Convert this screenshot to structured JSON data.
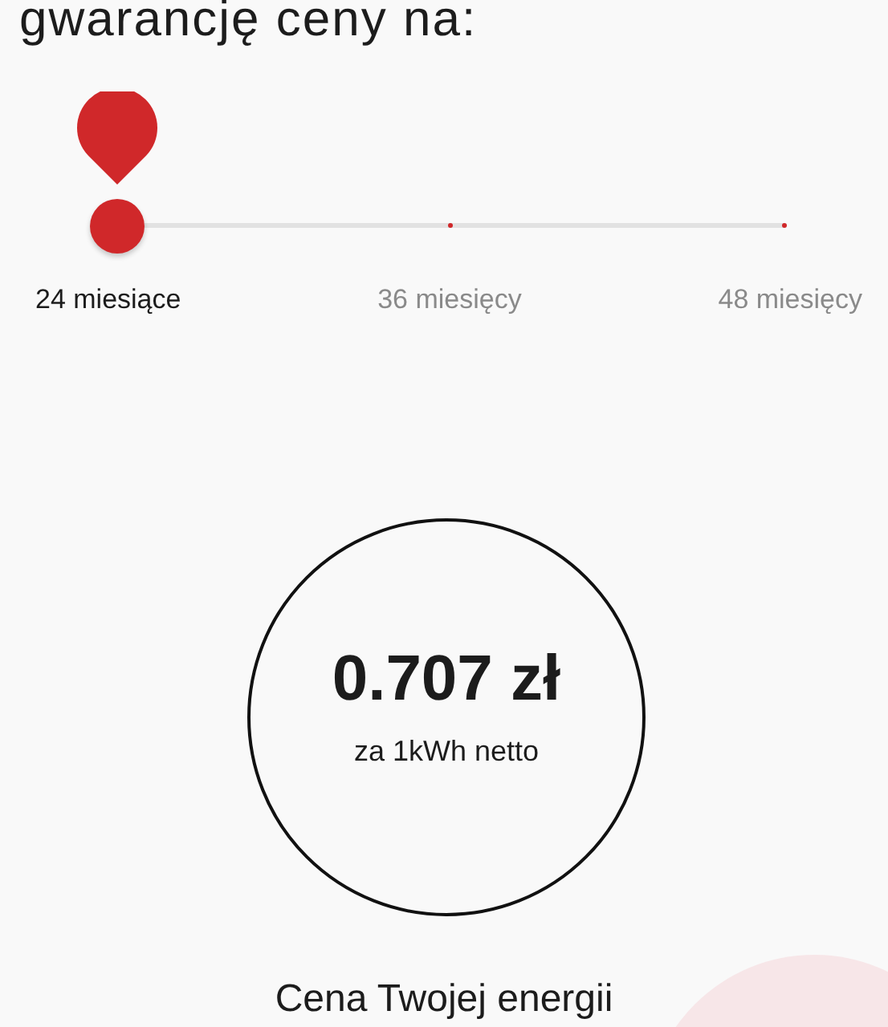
{
  "heading": "gwarancję ceny na:",
  "slider": {
    "level": 0,
    "options": [
      {
        "label": "24 miesiące",
        "selected": true
      },
      {
        "label": "36 miesięcy",
        "selected": false
      },
      {
        "label": "48 miesięcy",
        "selected": false
      }
    ]
  },
  "price": {
    "value": "0.707 zł",
    "unit": "za 1kWh netto"
  },
  "caption": "Cena Twojej energii"
}
